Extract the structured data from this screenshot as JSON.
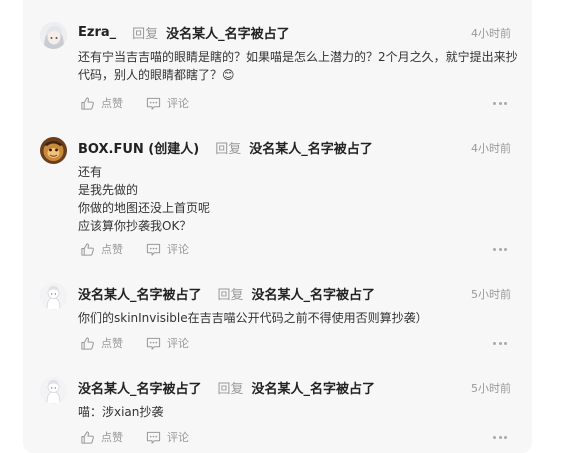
{
  "comments": [
    {
      "username": "Ezra_",
      "reply_word": "回复",
      "reply_target": "没名某人_名字被占了",
      "time": "4小时前",
      "text": "还有宁当吉吉喵的眼睛是瞎的？如果喵是怎么上潜力的？2个月之久，就宁提出来抄代码，别人的眼睛都瞎了？😊",
      "like_label": "点赞",
      "comment_label": "评论",
      "avatar_icon": "anime-girl-avatar"
    },
    {
      "username": "BOX.FUN (创建人)",
      "reply_word": "回复",
      "reply_target": "没名某人_名字被占了",
      "time": "4小时前",
      "text": "还有\n是我先做的\n你做的地图还没上首页呢\n应该算你抄袭我OK？",
      "like_label": "点赞",
      "comment_label": "评论",
      "avatar_icon": "brown-character-avatar"
    },
    {
      "username": "没名某人_名字被占了",
      "reply_word": "回复",
      "reply_target": "没名某人_名字被占了",
      "time": "5小时前",
      "text": "你们的skinInvisible在吉吉喵公开代码之前不得使用否则算抄袭）",
      "like_label": "点赞",
      "comment_label": "评论",
      "avatar_icon": "white-figure-avatar"
    },
    {
      "username": "没名某人_名字被占了",
      "reply_word": "回复",
      "reply_target": "没名某人_名字被占了",
      "time": "5小时前",
      "text": "喵：涉xian抄袭",
      "like_label": "点赞",
      "comment_label": "评论",
      "avatar_icon": "white-figure-avatar"
    }
  ]
}
